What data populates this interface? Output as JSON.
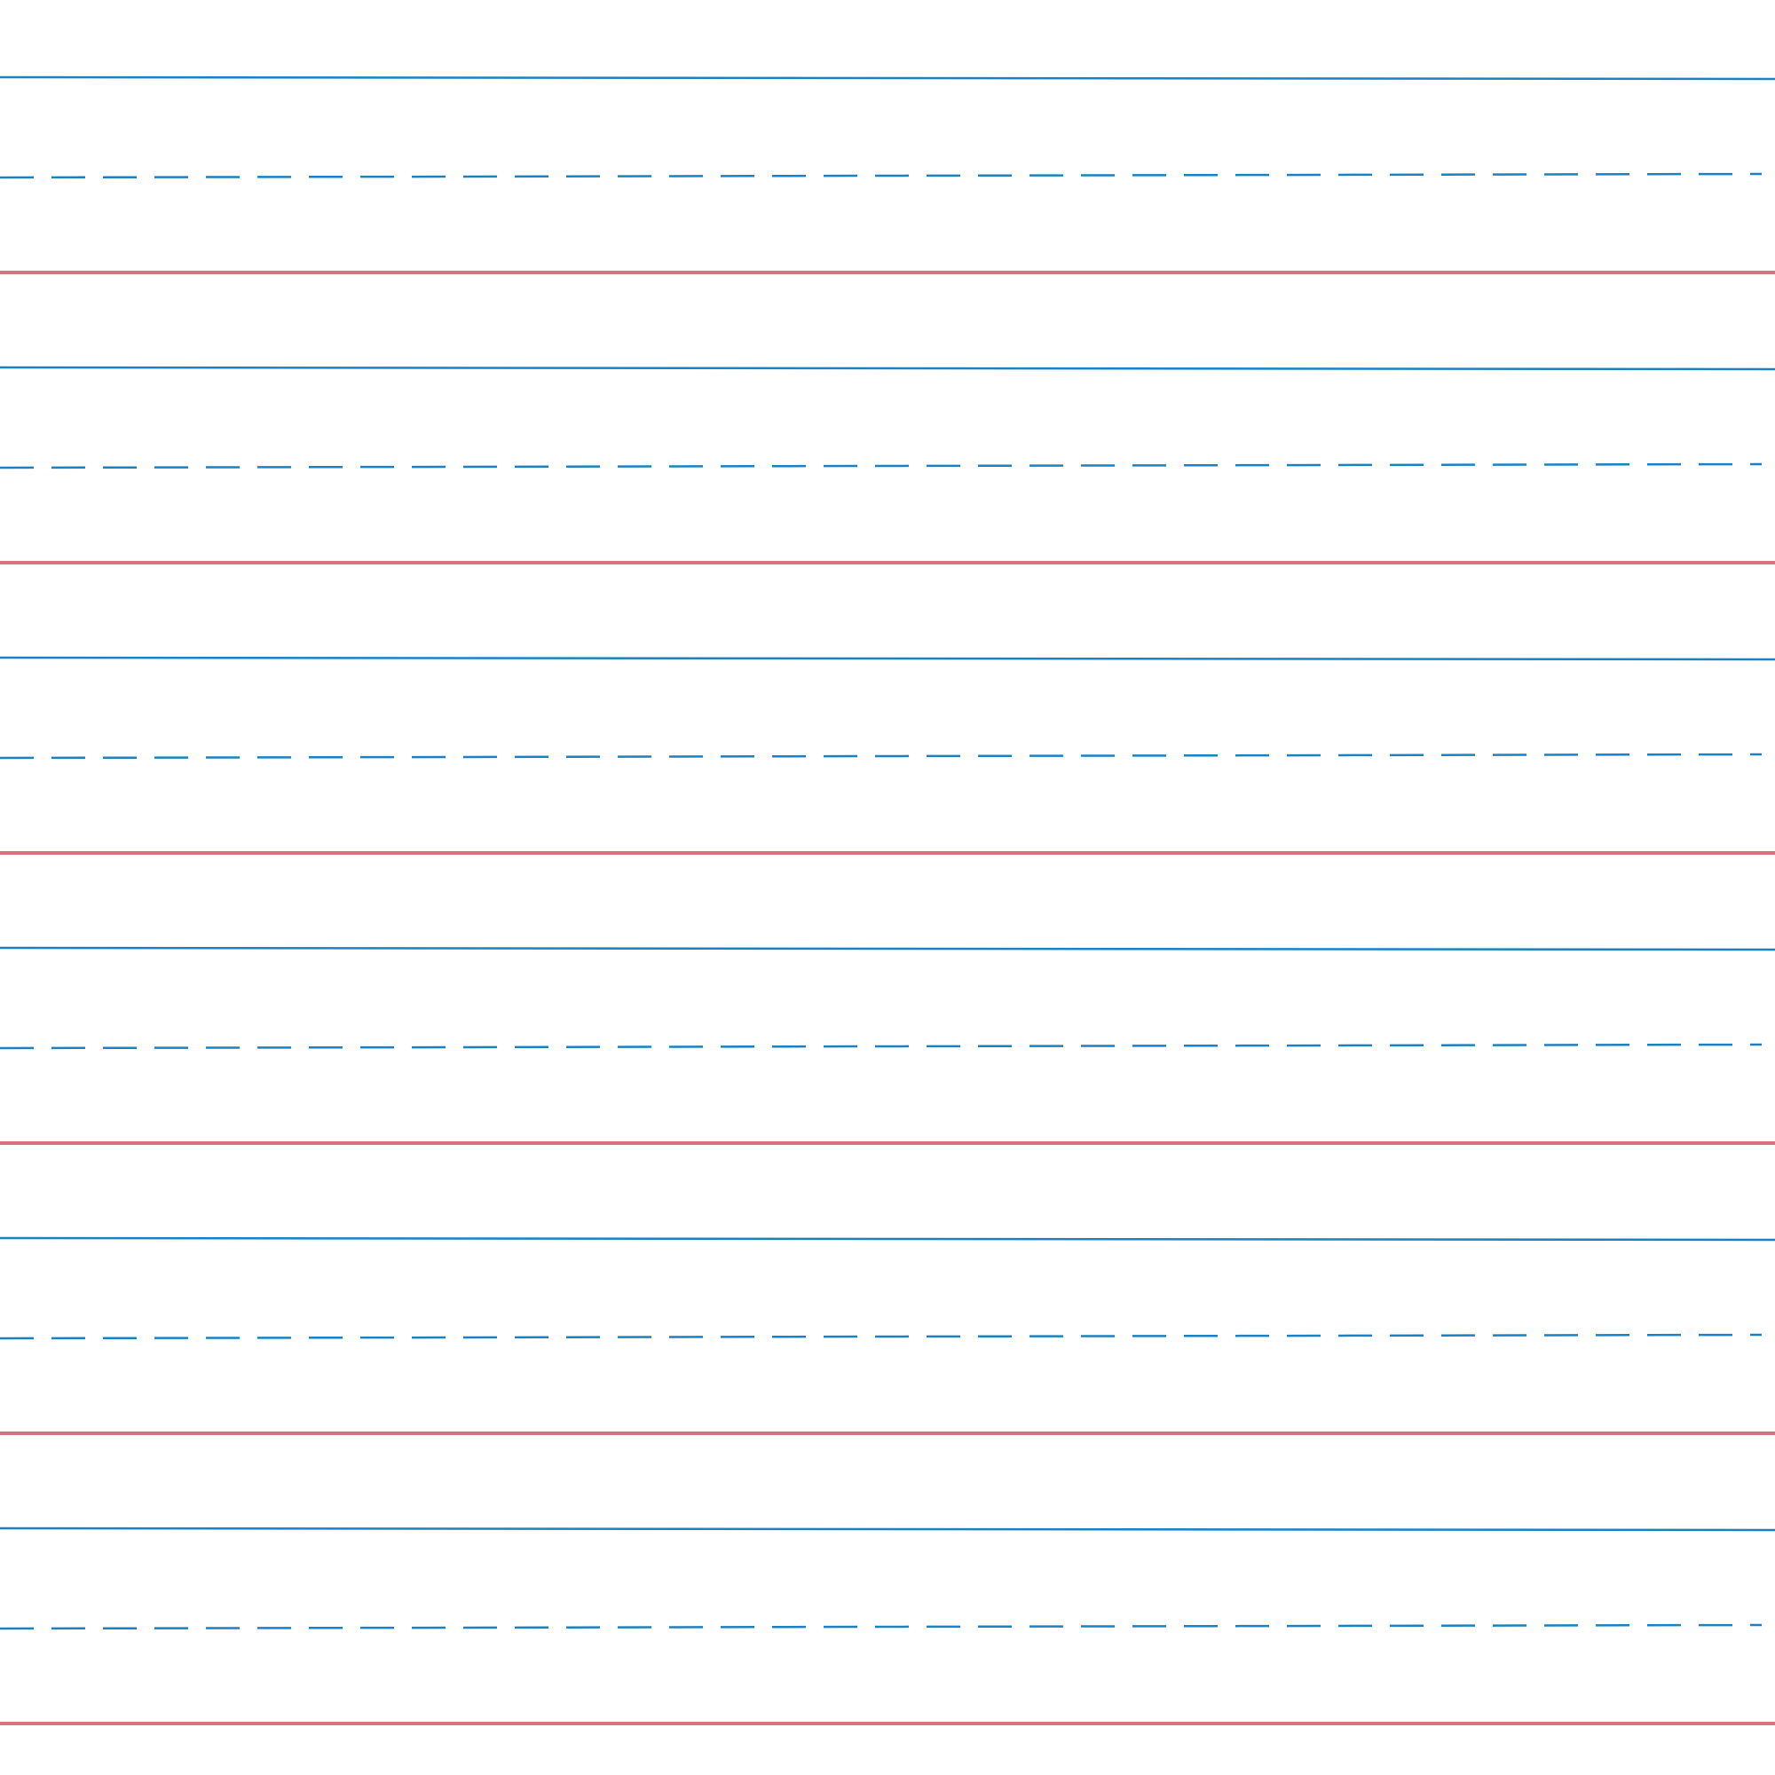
{
  "paper": {
    "style": "handwriting-practice-ruled",
    "background_color": "#ffffff",
    "row_count": 6,
    "line_pattern": [
      "headline-solid",
      "midline-dashed",
      "baseline-solid"
    ],
    "colors": {
      "headline": "#1a82c4",
      "midline": "#1a82c4",
      "baseline": "#d9727e"
    }
  }
}
